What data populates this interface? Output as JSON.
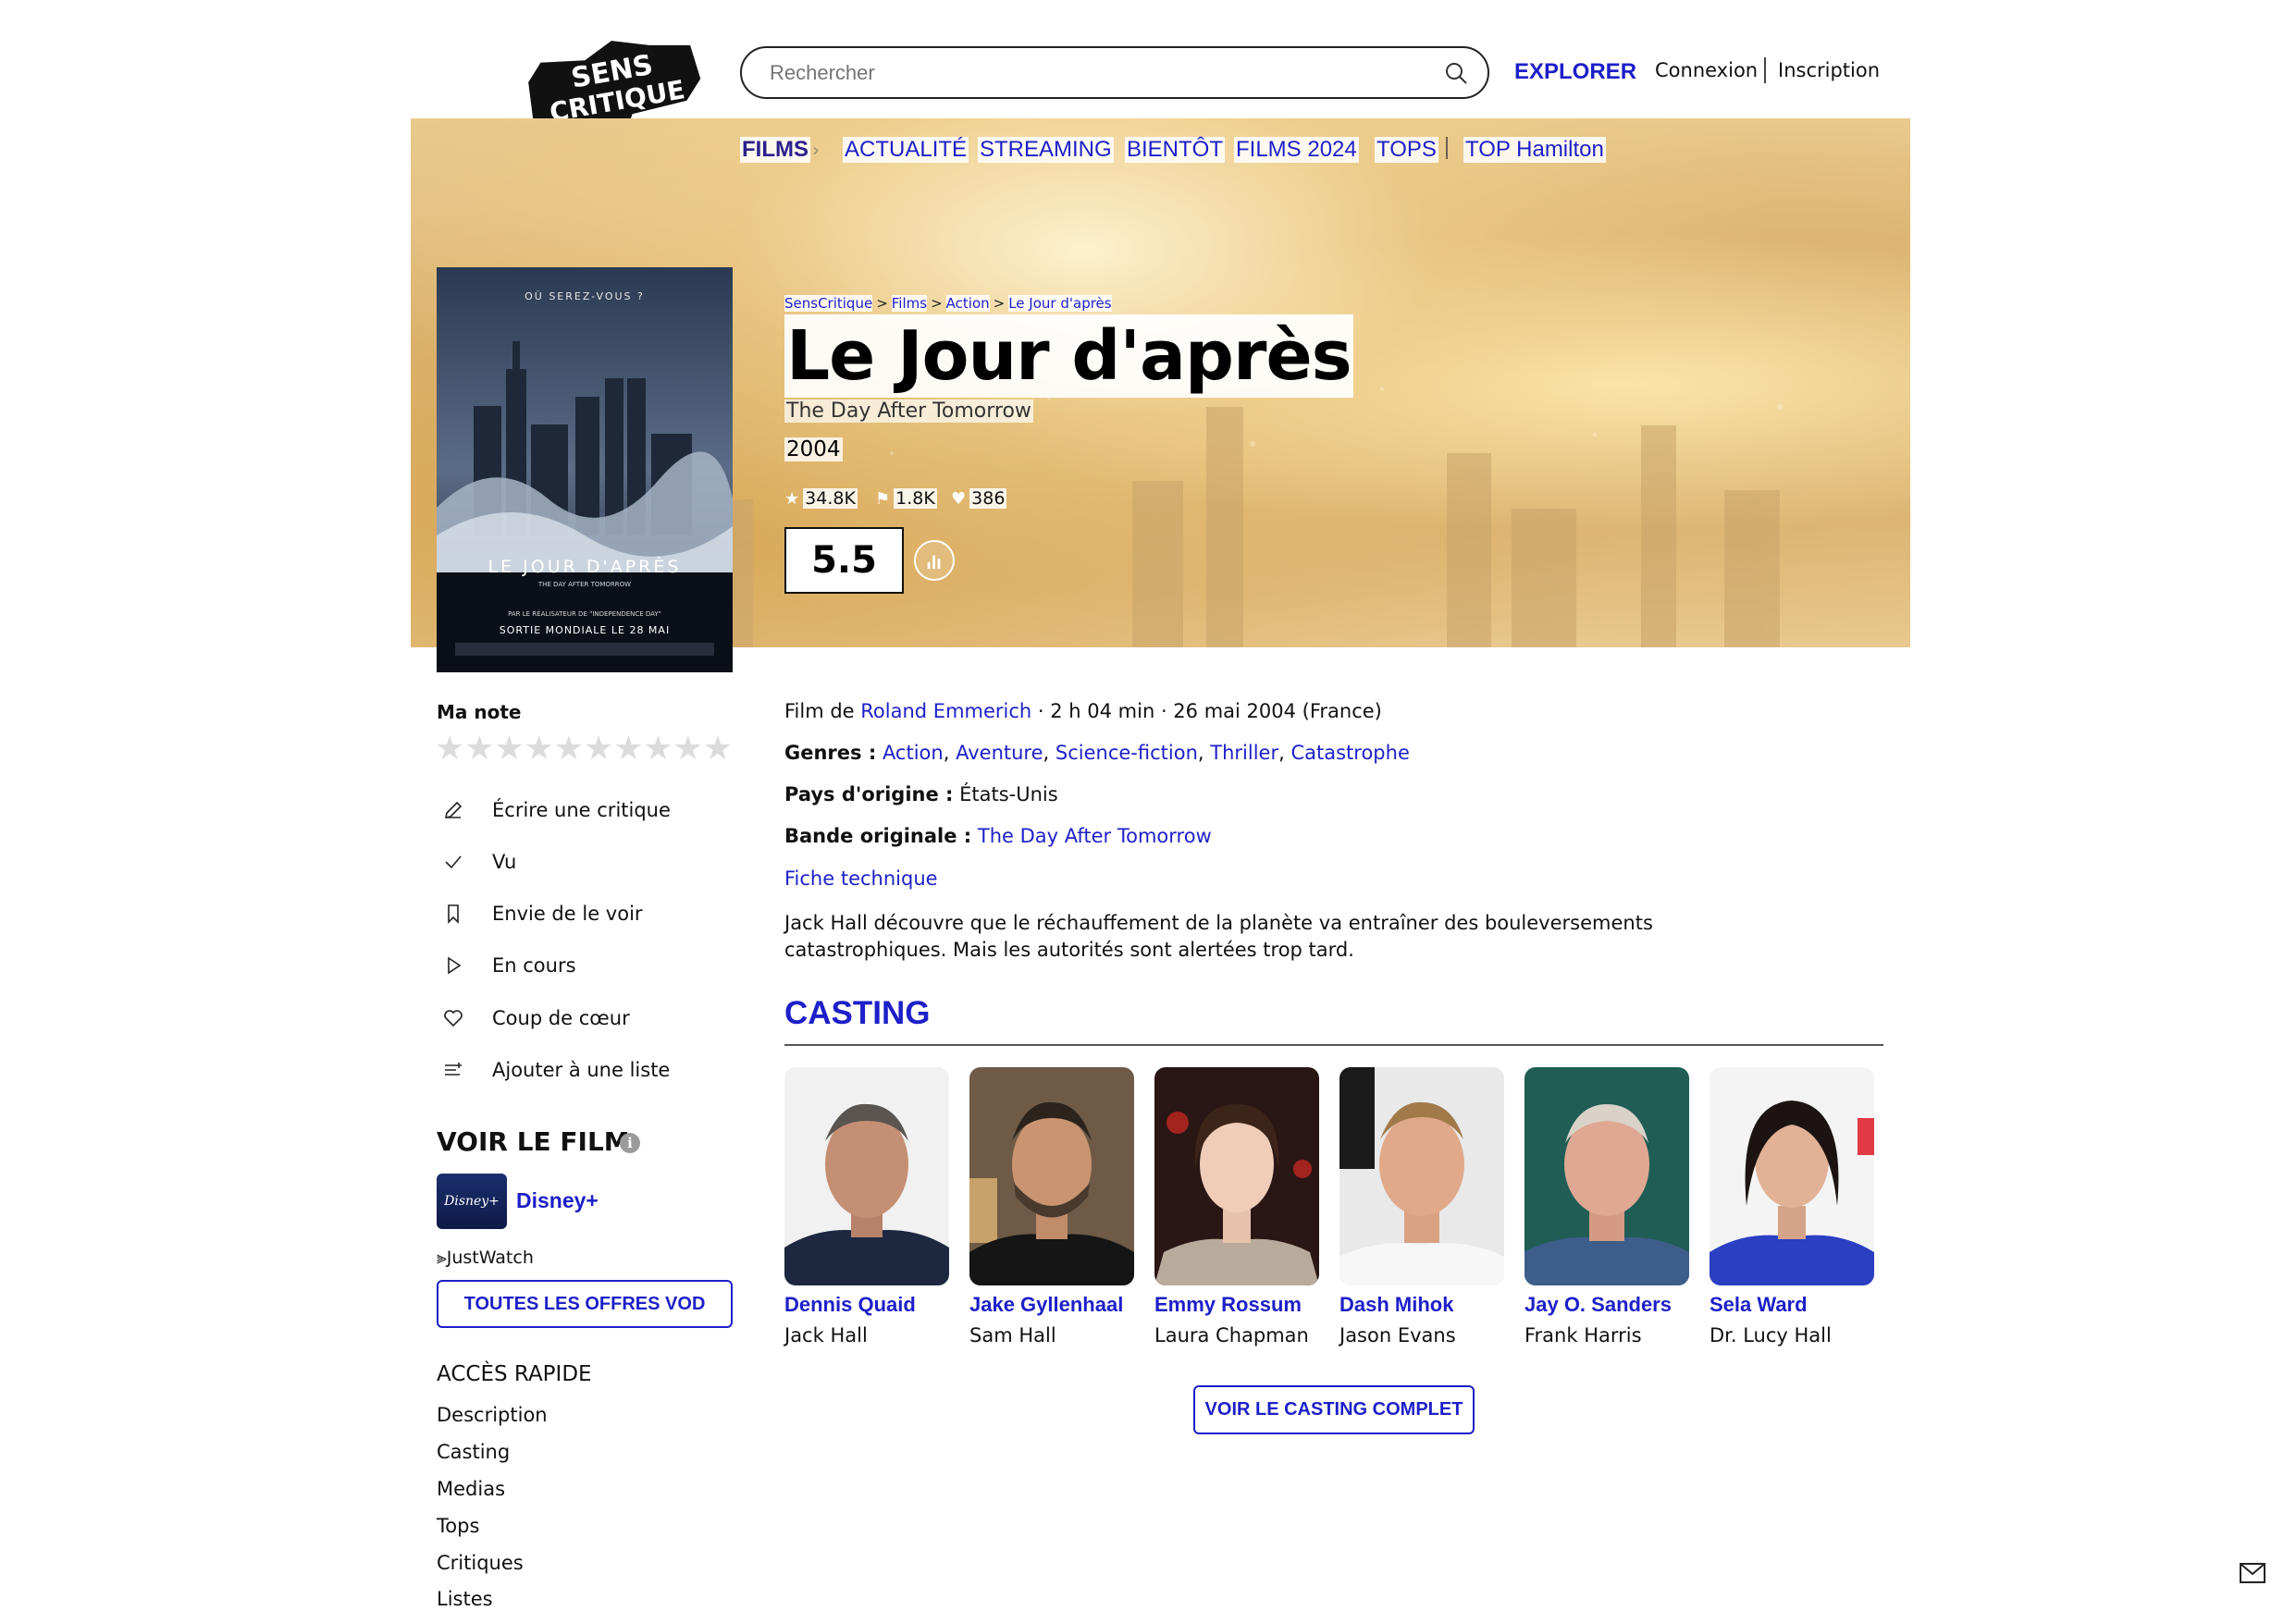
{
  "header": {
    "logo_line1": "SENS",
    "logo_line2": "CRITIQUE",
    "search_placeholder": "Rechercher",
    "explore": "EXPLORER",
    "login": "Connexion",
    "signup": "Inscription"
  },
  "nav": {
    "films": "FILMS",
    "chevron": "›",
    "items": [
      "ACTUALITÉ",
      "STREAMING",
      "BIENTÔT",
      "FILMS 2024",
      "TOPS",
      "TOP Hamilton"
    ]
  },
  "poster": {
    "tagline": "OÙ SEREZ-VOUS ?",
    "title": "LE JOUR D'APRÈS",
    "subtitle": "THE DAY AFTER TOMORROW",
    "director_line": "PAR LE RÉALISATEUR DE \"INDEPENDENCE DAY\"",
    "release_line": "SORTIE MONDIALE LE 28 MAI"
  },
  "breadcrumb": [
    "SensCritique",
    "Films",
    "Action",
    "Le Jour d'après"
  ],
  "breadcrumb_sep": ">",
  "movie": {
    "title": "Le Jour d'après",
    "original_title": "The Day After Tomorrow",
    "year": "2004",
    "ratings_count": "34.8K",
    "wishes_count": "1.8K",
    "favorites_count": "386",
    "score": "5.5"
  },
  "sidebar": {
    "my_rating_label": "Ma note",
    "stars_count": 10,
    "star_glyph": "★",
    "actions": [
      {
        "label": "Écrire une critique",
        "icon": "pencil-icon"
      },
      {
        "label": "Vu",
        "icon": "check-icon"
      },
      {
        "label": "Envie de le voir",
        "icon": "bookmark-icon"
      },
      {
        "label": "En cours",
        "icon": "play-icon"
      },
      {
        "label": "Coup de cœur",
        "icon": "heart-icon"
      },
      {
        "label": "Ajouter à une liste",
        "icon": "list-add-icon"
      }
    ],
    "watch_title": "VOIR LE FILM",
    "info_glyph": "i",
    "provider_logo_text": "Disney+",
    "provider_name": "Disney+",
    "justwatch": "JustWatch",
    "vod_button": "TOUTES LES OFFRES VOD",
    "quick_access_title": "ACCÈS RAPIDE",
    "quick_links": [
      "Description",
      "Casting",
      "Medias",
      "Tops",
      "Critiques",
      "Listes"
    ]
  },
  "details": {
    "film_de_prefix": "Film de ",
    "director": "Roland Emmerich",
    "duration_date": " · 2 h 04 min · 26 mai 2004 (France)",
    "genres_label": "Genres :",
    "genres": [
      "Action",
      "Aventure",
      "Science-fiction",
      "Thriller",
      "Catastrophe"
    ],
    "genre_sep": ",",
    "country_label": "Pays d'origine :",
    "country": "États-Unis",
    "original_label": "Bande originale :",
    "original_value": "The Day After Tomorrow",
    "tech_sheet": "Fiche technique",
    "synopsis": "Jack Hall découvre que le réchauffement de la planète va entraîner des bouleversements catastrophiques. Mais les autorités sont alertées trop tard."
  },
  "casting": {
    "title": "CASTING",
    "cast": [
      {
        "name": "Dennis Quaid",
        "role": "Jack Hall"
      },
      {
        "name": "Jake Gyllenhaal",
        "role": "Sam Hall"
      },
      {
        "name": "Emmy Rossum",
        "role": "Laura Chapman"
      },
      {
        "name": "Dash Mihok",
        "role": "Jason Evans"
      },
      {
        "name": "Jay O. Sanders",
        "role": "Frank Harris"
      },
      {
        "name": "Sela Ward",
        "role": "Dr. Lucy Hall"
      }
    ],
    "full_cast_button": "VOIR LE CASTING COMPLET"
  },
  "colors": {
    "accent_blue": "#1d1fc8",
    "nav_films": "#2a1f8c",
    "hero_gold": "#e3c085"
  }
}
